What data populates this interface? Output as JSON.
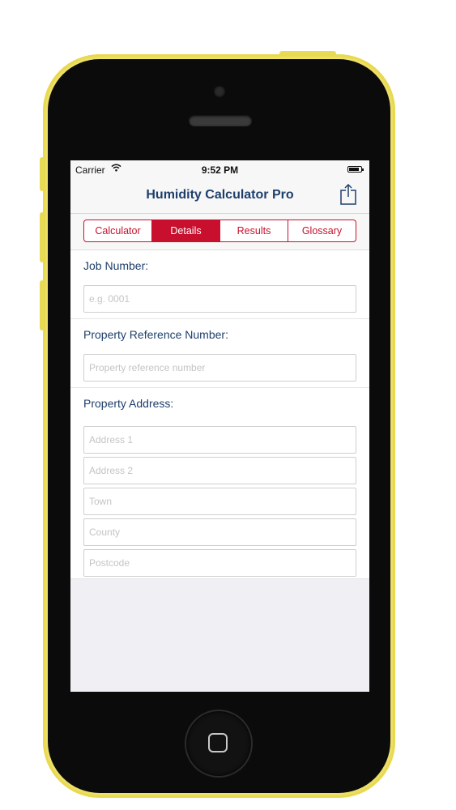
{
  "status_bar": {
    "carrier": "Carrier",
    "time": "9:52 PM"
  },
  "nav": {
    "title": "Humidity Calculator Pro",
    "share_icon": "share-icon"
  },
  "tabs": [
    {
      "label": "Calculator",
      "active": false
    },
    {
      "label": "Details",
      "active": true
    },
    {
      "label": "Results",
      "active": false
    },
    {
      "label": "Glossary",
      "active": false
    }
  ],
  "form": {
    "job_number": {
      "label": "Job Number:",
      "placeholder": "e.g. 0001",
      "value": ""
    },
    "property_reference": {
      "label": "Property Reference Number:",
      "placeholder": "Property reference number",
      "value": ""
    },
    "property_address": {
      "label": "Property Address:",
      "fields": [
        {
          "placeholder": "Address 1",
          "value": ""
        },
        {
          "placeholder": "Address 2",
          "value": ""
        },
        {
          "placeholder": "Town",
          "value": ""
        },
        {
          "placeholder": "County",
          "value": ""
        },
        {
          "placeholder": "Postcode",
          "value": ""
        }
      ]
    }
  },
  "colors": {
    "accent": "#c8102e",
    "title": "#1e3f6c",
    "phone_body": "#f1e46a"
  }
}
